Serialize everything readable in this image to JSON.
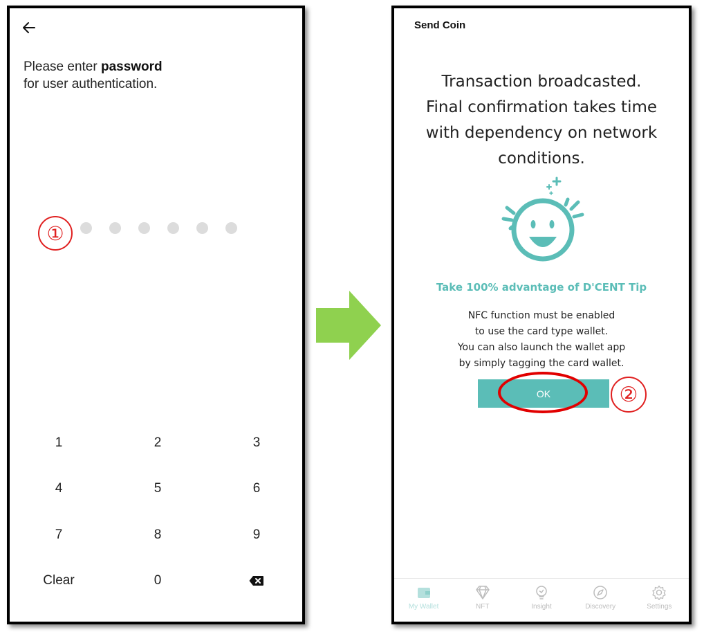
{
  "left_screen": {
    "prompt_line1_prefix": "Please enter ",
    "prompt_line1_bold": "password",
    "prompt_line2": "for user authentication.",
    "pin_dot_count": 6,
    "step_marker": "①",
    "keypad": [
      [
        "1",
        "2",
        "3"
      ],
      [
        "4",
        "5",
        "6"
      ],
      [
        "7",
        "8",
        "9"
      ],
      [
        "Clear",
        "0",
        "backspace-icon"
      ]
    ]
  },
  "right_screen": {
    "title": "Send Coin",
    "message_lines": [
      "Transaction broadcasted.",
      "Final confirmation takes time",
      "with dependency on network",
      "conditions."
    ],
    "tip_title": "Take 100% advantage of D'CENT Tip",
    "tip_lines": [
      "NFC function must be enabled",
      "to use the card type wallet.",
      "You can also launch the wallet app",
      "by simply tagging the card wallet."
    ],
    "ok_label": "OK",
    "step_marker": "②",
    "tabs": [
      {
        "label": "My Wallet",
        "icon": "wallet-icon",
        "active": true
      },
      {
        "label": "NFT",
        "icon": "diamond-icon",
        "active": false
      },
      {
        "label": "Insight",
        "icon": "lightbulb-icon",
        "active": false
      },
      {
        "label": "Discovery",
        "icon": "compass-icon",
        "active": false
      },
      {
        "label": "Settings",
        "icon": "gear-icon",
        "active": false
      }
    ]
  },
  "colors": {
    "accent": "#5bbdb7",
    "annotation_red": "#e02020",
    "arrow_green": "#8fd14f"
  }
}
